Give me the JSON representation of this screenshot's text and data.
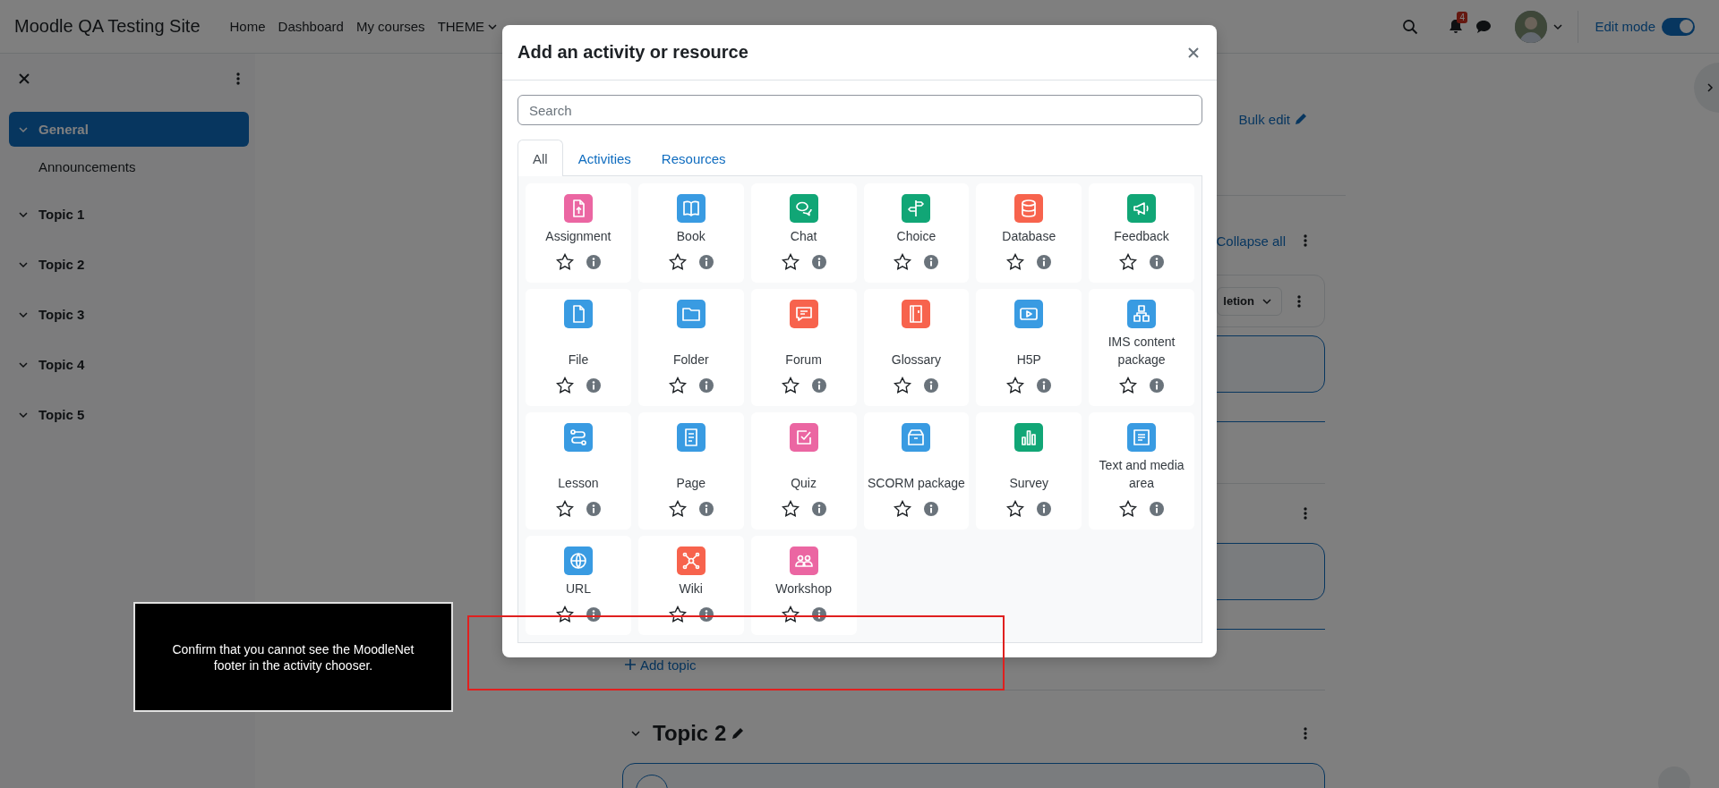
{
  "navbar": {
    "site_name": "Moodle QA Testing Site",
    "links": [
      {
        "label": "Home",
        "kind": "link"
      },
      {
        "label": "Dashboard",
        "kind": "link"
      },
      {
        "label": "My courses",
        "kind": "link"
      },
      {
        "label": "THEME",
        "kind": "dropdown"
      }
    ],
    "notification_count": "4",
    "edit_mode": {
      "label": "Edit mode",
      "on": true
    }
  },
  "course_index": {
    "items": [
      {
        "label": "General",
        "selected": true,
        "expanded": true,
        "children": [
          {
            "label": "Announcements"
          }
        ]
      },
      {
        "label": "Topic 1",
        "selected": false,
        "expanded": true
      },
      {
        "label": "Topic 2",
        "selected": false,
        "expanded": true
      },
      {
        "label": "Topic 3",
        "selected": false,
        "expanded": true
      },
      {
        "label": "Topic 4",
        "selected": false,
        "expanded": true
      },
      {
        "label": "Topic 5",
        "selected": false,
        "expanded": true
      }
    ]
  },
  "course": {
    "bulk_edit": "Bulk edit",
    "collapse_all": "Collapse all",
    "completion_dropdown": "letion",
    "add_topic": "Add topic",
    "section_title": "Topic 2"
  },
  "modal": {
    "title": "Add an activity or resource",
    "search": {
      "placeholder": "Search"
    },
    "tabs": [
      {
        "label": "All",
        "selected": true
      },
      {
        "label": "Activities",
        "selected": false
      },
      {
        "label": "Resources",
        "selected": false
      }
    ],
    "items": [
      {
        "name": "Assignment",
        "color": "#eb66a2",
        "starred": false
      },
      {
        "name": "Book",
        "color": "#399be2",
        "starred": false
      },
      {
        "name": "Chat",
        "color": "#11a676",
        "starred": false
      },
      {
        "name": "Choice",
        "color": "#11a676",
        "starred": false
      },
      {
        "name": "Database",
        "color": "#f7634d",
        "starred": false
      },
      {
        "name": "Feedback",
        "color": "#11a676",
        "starred": false
      },
      {
        "name": "File",
        "color": "#399be2",
        "starred": false
      },
      {
        "name": "Folder",
        "color": "#399be2",
        "starred": false
      },
      {
        "name": "Forum",
        "color": "#f7634d",
        "starred": false
      },
      {
        "name": "Glossary",
        "color": "#f7634d",
        "starred": false
      },
      {
        "name": "H5P",
        "color": "#399be2",
        "starred": false
      },
      {
        "name": "IMS content package",
        "color": "#399be2",
        "starred": false
      },
      {
        "name": "Lesson",
        "color": "#399be2",
        "starred": false
      },
      {
        "name": "Page",
        "color": "#399be2",
        "starred": false
      },
      {
        "name": "Quiz",
        "color": "#eb66a2",
        "starred": false
      },
      {
        "name": "SCORM package",
        "color": "#399be2",
        "starred": false
      },
      {
        "name": "Survey",
        "color": "#11a676",
        "starred": false
      },
      {
        "name": "Text and media area",
        "color": "#399be2",
        "starred": false
      },
      {
        "name": "URL",
        "color": "#399be2",
        "starred": false
      },
      {
        "name": "Wiki",
        "color": "#f7634d",
        "starred": false
      },
      {
        "name": "Workshop",
        "color": "#eb66a2",
        "starred": false
      }
    ]
  },
  "annotation": {
    "text": "Confirm that you cannot see the MoodleNet footer in the activity chooser."
  }
}
